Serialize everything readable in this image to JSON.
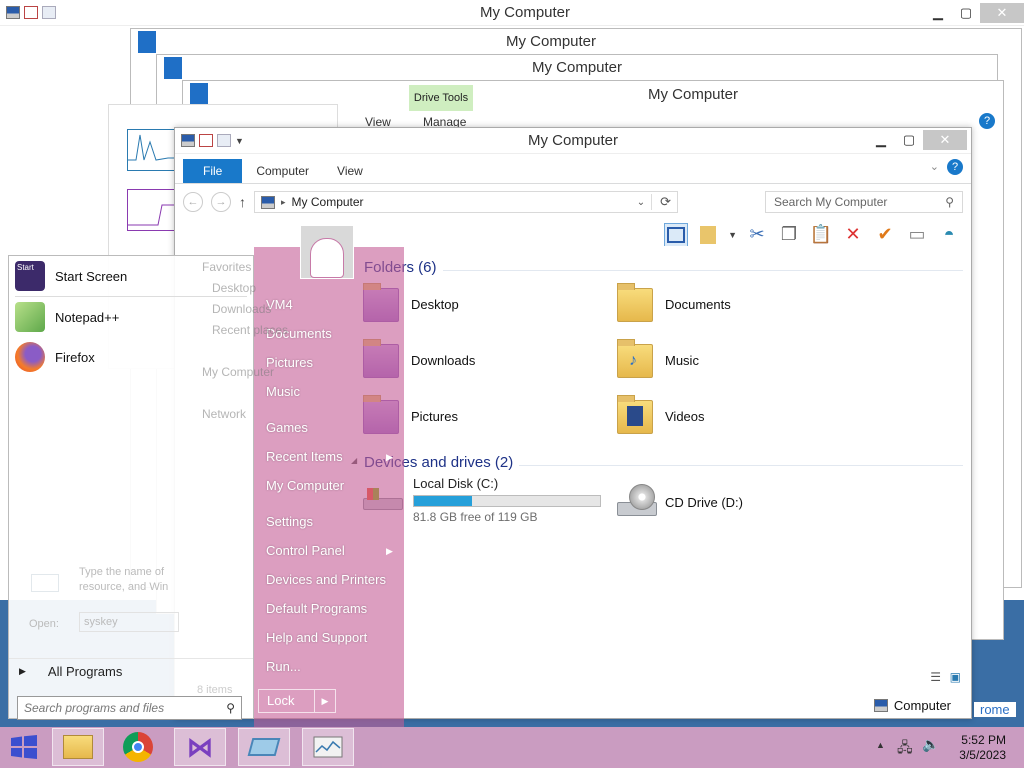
{
  "windows": {
    "title": "My Computer",
    "back_title_1": "My Computer",
    "back_title_2": "My Computer",
    "back_title_3": "My Computer",
    "back_title_4": "My Computer",
    "drive_tools": "Drive Tools",
    "manage_tab": "Manage",
    "view_tab_back": "View"
  },
  "explorer": {
    "tabs": [
      "File",
      "Computer",
      "View"
    ],
    "address": "My Computer",
    "search_placeholder": "Search My Computer",
    "folders_header": "Folders (6)",
    "folders": [
      "Desktop",
      "Documents",
      "Downloads",
      "Music",
      "Pictures",
      "Videos"
    ],
    "devices_header": "Devices and drives (2)",
    "drive_c_label": "Local Disk (C:)",
    "drive_c_free": "81.8 GB free of 119 GB",
    "drive_c_used_fraction": 0.31,
    "drive_d_label": "CD Drive (D:)",
    "status_location": "Computer",
    "behind_status": "8 items"
  },
  "nav_pane": {
    "favorites": "Favorites",
    "desktop": "Desktop",
    "downloads": "Downloads",
    "recent": "Recent places",
    "computer": "My Computer",
    "network": "Network"
  },
  "run_dialog": {
    "text": "Type the name of",
    "text2": "resource, and Win",
    "open_label": "Open:",
    "open_value": "syskey"
  },
  "start_menu": {
    "programs": [
      "Start Screen",
      "Notepad++",
      "Firefox"
    ],
    "all_programs": "All Programs",
    "search_placeholder": "Search programs and files",
    "user": "VM4",
    "right_items": [
      "Documents",
      "Pictures",
      "Music",
      "Games",
      "Recent Items",
      "My Computer",
      "Settings",
      "Control Panel",
      "Devices and Printers",
      "Default Programs",
      "Help and Support",
      "Run..."
    ],
    "lock": "Lock"
  },
  "taskbar": {
    "time": "5:52 PM",
    "date": "3/5/2023",
    "chrome_label": "rome"
  },
  "colors": {
    "accent": "#1979ca",
    "start_menu_right": "#c55e96",
    "taskbar": "#d7a0c3"
  }
}
